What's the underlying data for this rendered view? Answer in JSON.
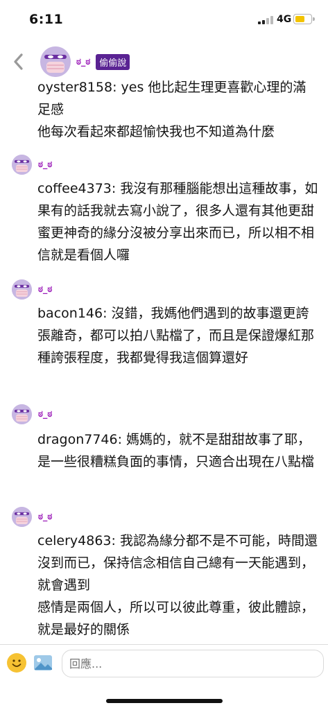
{
  "status_bar": {
    "time": "6:11",
    "network": "4G",
    "battery_color": "#f3c300"
  },
  "thread": {
    "op": {
      "name": "ಠ_ಠ",
      "tag": "偷偷說",
      "text": "oyster8158: yes 他比起生理更喜歡心理的滿足感\n他每次看起來都超愉快我也不知道為什麼"
    },
    "comments": [
      {
        "name": "ಠ_ಠ",
        "text": "coffee4373: 我沒有那種腦能想出這種故事，如果有的話我就去寫小說了，很多人還有其他更甜蜜更神奇的緣分沒被分享出來而已，所以相不相信就是看個人囉"
      },
      {
        "name": "ಠ_ಠ",
        "text": "bacon146: 沒錯，我媽他們遇到的故事還更誇張離奇，都可以拍八點檔了，而且是保證爆紅那種誇張程度，我都覺得我這個算還好"
      },
      {
        "name": "ಠ_ಠ",
        "text": "dragon7746: 媽媽的，就不是甜甜故事了耶，是一些很糟糕負面的事情，只適合出現在八點檔"
      },
      {
        "name": "ಠ_ಠ",
        "text": "celery4863: 我認為緣分都不是不可能，時間還沒到而已，保持信念相信自己總有一天能遇到，就會遇到\n感情是兩個人，所以可以彼此尊重，彼此體諒，就是最好的關係"
      }
    ]
  },
  "reply_bar": {
    "placeholder": "回應..."
  },
  "icons": {
    "back": "chevron-left-icon",
    "avatar": "masked-face-avatar",
    "emoji": "smiley-icon",
    "image": "image-icon"
  },
  "colors": {
    "name": "#9b1bb8",
    "tag_bg": "#5a2393",
    "avatar_bg": "#c7b6e2"
  }
}
